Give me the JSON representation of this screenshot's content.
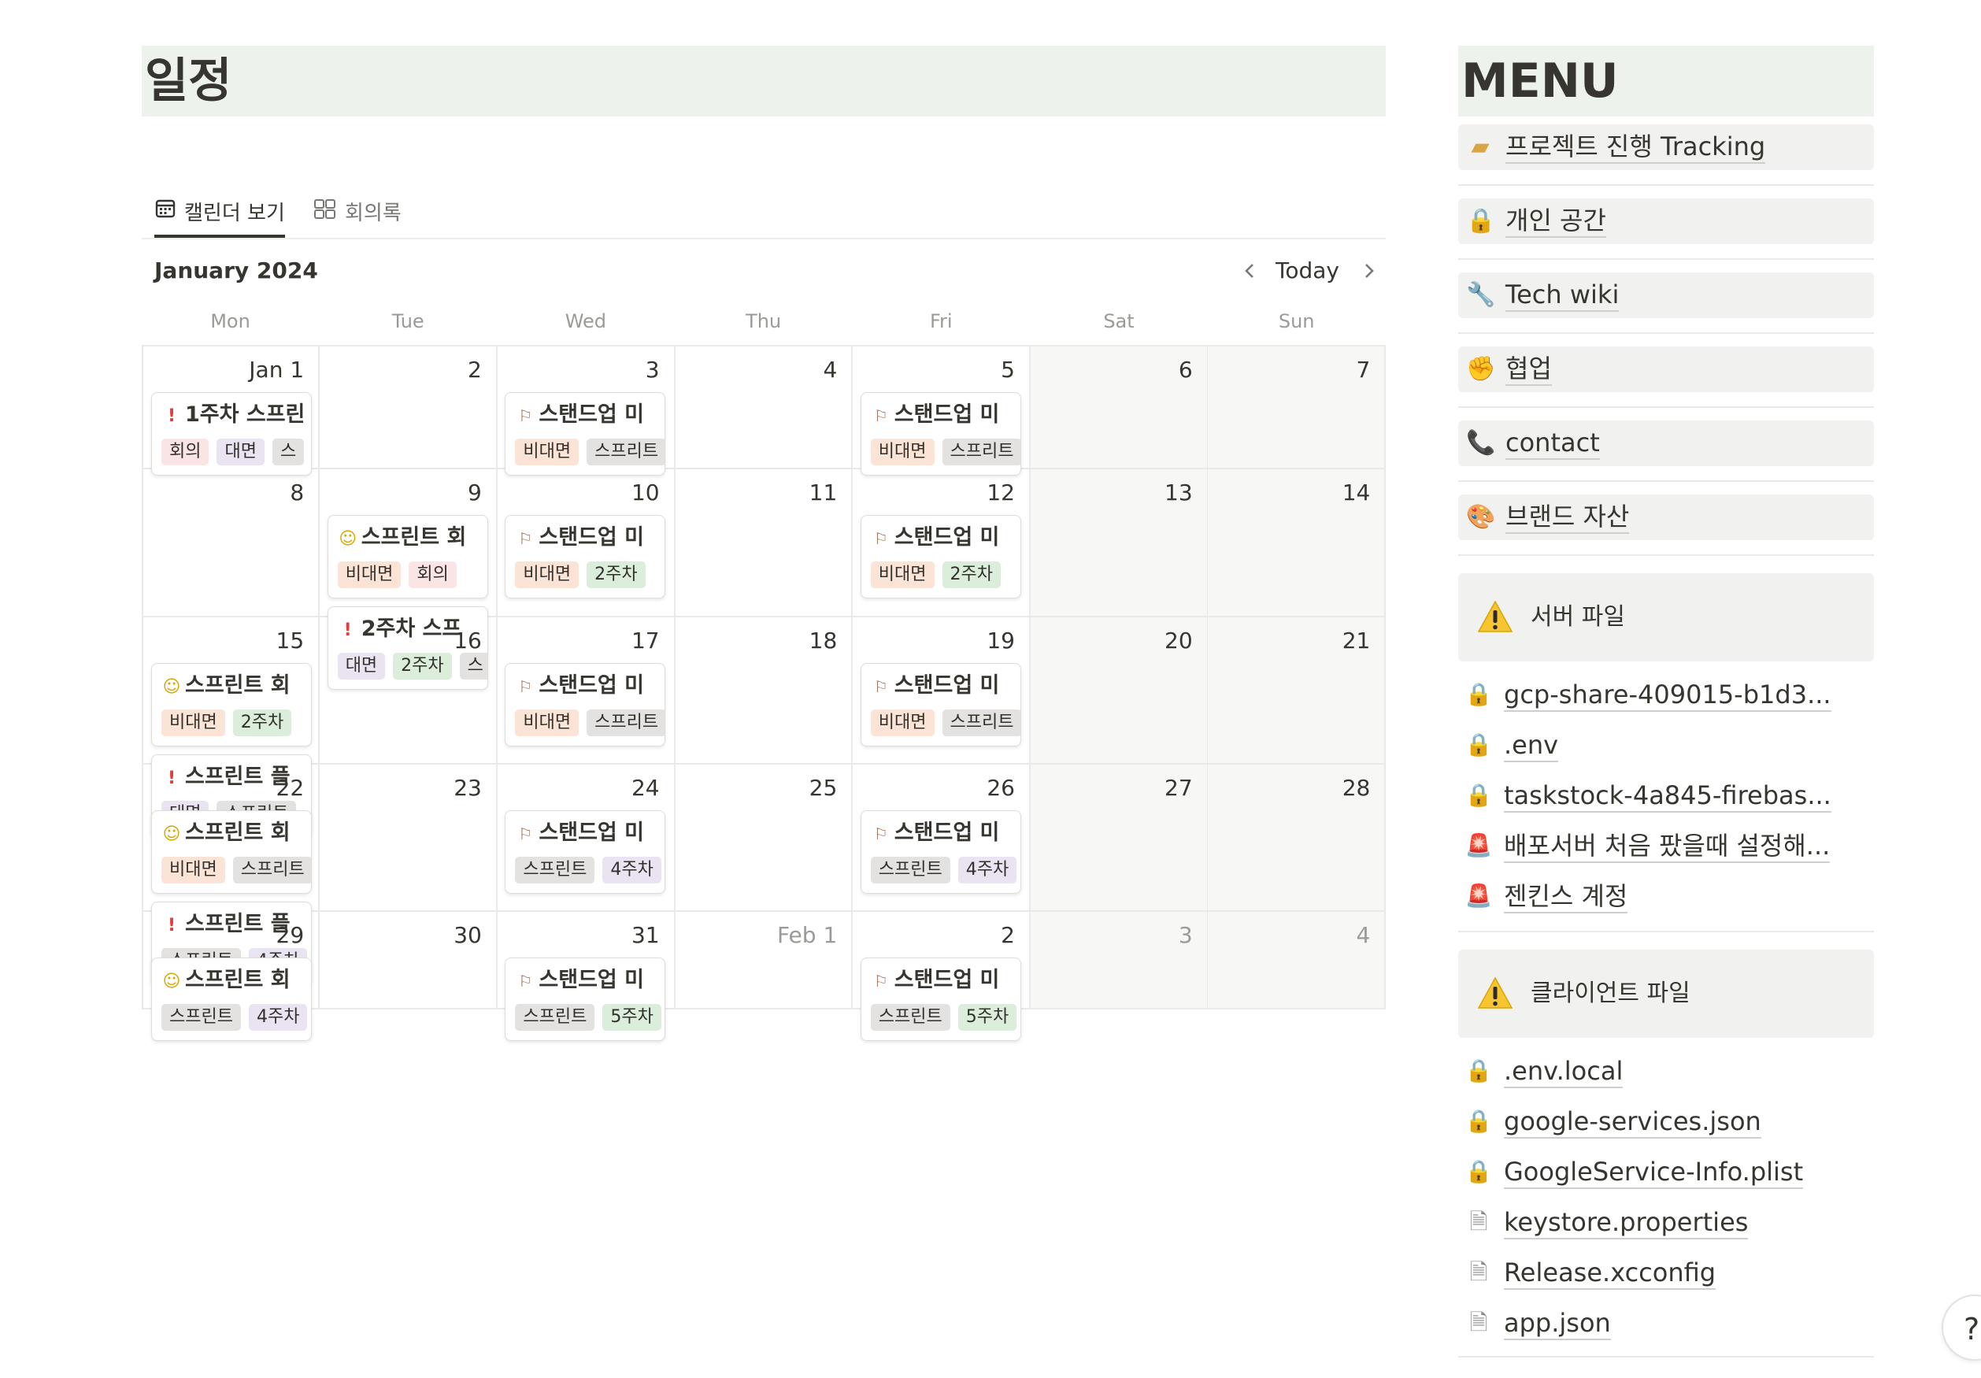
{
  "page": {
    "title": "일정"
  },
  "tabs": [
    {
      "label": "캘린더 보기",
      "icon": "calendar-icon",
      "active": true
    },
    {
      "label": "회의록",
      "icon": "gallery-icon",
      "active": false
    }
  ],
  "calendar": {
    "month_label": "January 2024",
    "today_label": "Today",
    "weekdays": [
      "Mon",
      "Tue",
      "Wed",
      "Thu",
      "Fri",
      "Sat",
      "Sun"
    ],
    "weeks": [
      {
        "days": [
          {
            "label": "Jan 1",
            "events": [
              {
                "icon": "exclamation-icon",
                "title": "1주차 스프린",
                "tags": [
                  {
                    "text": "회의",
                    "color": "red"
                  },
                  {
                    "text": "대면",
                    "color": "purple"
                  },
                  {
                    "text": "스",
                    "color": "gray"
                  }
                ]
              }
            ]
          },
          {
            "label": "2",
            "events": []
          },
          {
            "label": "3",
            "events": [
              {
                "icon": "runner-icon",
                "title": "스탠드업 미",
                "tags": [
                  {
                    "text": "비대면",
                    "color": "orange"
                  },
                  {
                    "text": "스프리트",
                    "color": "gray"
                  }
                ]
              }
            ]
          },
          {
            "label": "4",
            "events": []
          },
          {
            "label": "5",
            "events": [
              {
                "icon": "runner-icon",
                "title": "스탠드업 미",
                "tags": [
                  {
                    "text": "비대면",
                    "color": "orange"
                  },
                  {
                    "text": "스프리트",
                    "color": "gray"
                  }
                ]
              }
            ]
          },
          {
            "label": "6",
            "events": []
          },
          {
            "label": "7",
            "events": []
          }
        ]
      },
      {
        "days": [
          {
            "label": "8",
            "events": []
          },
          {
            "label": "9",
            "events": [
              {
                "icon": "smile-icon",
                "title": "스프린트 회",
                "tags": [
                  {
                    "text": "비대면",
                    "color": "orange"
                  },
                  {
                    "text": "회의",
                    "color": "red"
                  },
                  {
                    "text": "",
                    "color": "gray"
                  }
                ]
              },
              {
                "icon": "exclamation-icon",
                "title": "2주차 스프",
                "tags": [
                  {
                    "text": "대면",
                    "color": "purple"
                  },
                  {
                    "text": "2주차",
                    "color": "green"
                  },
                  {
                    "text": "스",
                    "color": "gray"
                  }
                ]
              }
            ]
          },
          {
            "label": "10",
            "events": [
              {
                "icon": "runner-icon",
                "title": "스탠드업 미",
                "tags": [
                  {
                    "text": "비대면",
                    "color": "orange"
                  },
                  {
                    "text": "2주차",
                    "color": "green"
                  }
                ]
              }
            ]
          },
          {
            "label": "11",
            "events": []
          },
          {
            "label": "12",
            "events": [
              {
                "icon": "runner-icon",
                "title": "스탠드업 미",
                "tags": [
                  {
                    "text": "비대면",
                    "color": "orange"
                  },
                  {
                    "text": "2주차",
                    "color": "green"
                  }
                ]
              }
            ]
          },
          {
            "label": "13",
            "events": []
          },
          {
            "label": "14",
            "events": []
          }
        ]
      },
      {
        "days": [
          {
            "label": "15",
            "events": [
              {
                "icon": "smile-icon",
                "title": "스프린트 회",
                "tags": [
                  {
                    "text": "비대면",
                    "color": "orange"
                  },
                  {
                    "text": "2주차",
                    "color": "green"
                  }
                ]
              },
              {
                "icon": "exclamation-icon",
                "title": "스프린트 플",
                "tags": [
                  {
                    "text": "대면",
                    "color": "purple"
                  },
                  {
                    "text": "스프린트",
                    "color": "gray"
                  }
                ]
              }
            ]
          },
          {
            "label": "16",
            "events": []
          },
          {
            "label": "17",
            "events": [
              {
                "icon": "runner-icon",
                "title": "스탠드업 미",
                "tags": [
                  {
                    "text": "비대면",
                    "color": "orange"
                  },
                  {
                    "text": "스프리트",
                    "color": "gray"
                  }
                ]
              }
            ]
          },
          {
            "label": "18",
            "events": []
          },
          {
            "label": "19",
            "events": [
              {
                "icon": "runner-icon",
                "title": "스탠드업 미",
                "tags": [
                  {
                    "text": "비대면",
                    "color": "orange"
                  },
                  {
                    "text": "스프리트",
                    "color": "gray"
                  }
                ]
              }
            ]
          },
          {
            "label": "20",
            "events": []
          },
          {
            "label": "21",
            "events": []
          }
        ]
      },
      {
        "days": [
          {
            "label": "22",
            "events": [
              {
                "icon": "smile-icon",
                "title": "스프린트 회",
                "tags": [
                  {
                    "text": "비대면",
                    "color": "orange"
                  },
                  {
                    "text": "스프리트",
                    "color": "gray"
                  }
                ]
              },
              {
                "icon": "exclamation-icon",
                "title": "스프린트 플",
                "tags": [
                  {
                    "text": "스프린트",
                    "color": "gray"
                  },
                  {
                    "text": "4주차",
                    "color": "purple"
                  }
                ]
              }
            ]
          },
          {
            "label": "23",
            "events": []
          },
          {
            "label": "24",
            "events": [
              {
                "icon": "runner-icon",
                "title": "스탠드업 미",
                "tags": [
                  {
                    "text": "스프린트",
                    "color": "gray"
                  },
                  {
                    "text": "4주차",
                    "color": "purple"
                  }
                ]
              }
            ]
          },
          {
            "label": "25",
            "events": []
          },
          {
            "label": "26",
            "events": [
              {
                "icon": "runner-icon",
                "title": "스탠드업 미",
                "tags": [
                  {
                    "text": "스프린트",
                    "color": "gray"
                  },
                  {
                    "text": "4주차",
                    "color": "purple"
                  }
                ]
              }
            ]
          },
          {
            "label": "27",
            "events": []
          },
          {
            "label": "28",
            "events": []
          }
        ]
      },
      {
        "days": [
          {
            "label": "29",
            "events": [
              {
                "icon": "smile-icon",
                "title": "스프린트 회",
                "tags": [
                  {
                    "text": "스프린트",
                    "color": "gray"
                  },
                  {
                    "text": "4주차",
                    "color": "purple"
                  }
                ]
              }
            ]
          },
          {
            "label": "30",
            "events": []
          },
          {
            "label": "31",
            "events": [
              {
                "icon": "runner-icon",
                "title": "스탠드업 미",
                "tags": [
                  {
                    "text": "스프린트",
                    "color": "gray"
                  },
                  {
                    "text": "5주차",
                    "color": "green"
                  }
                ]
              }
            ]
          },
          {
            "label": "Feb 1",
            "muted": true,
            "events": []
          },
          {
            "label": "2",
            "events": [
              {
                "icon": "runner-icon",
                "title": "스탠드업 미",
                "tags": [
                  {
                    "text": "스프린트",
                    "color": "gray"
                  },
                  {
                    "text": "5주차",
                    "color": "green"
                  }
                ]
              }
            ]
          },
          {
            "label": "3",
            "muted": true,
            "events": []
          },
          {
            "label": "4",
            "muted": true,
            "events": []
          }
        ]
      }
    ]
  },
  "sidebar": {
    "title": "MENU",
    "items": [
      {
        "icon": "memo-icon",
        "label": "프로젝트 진행 Tracking"
      },
      {
        "icon": "lock-icon",
        "label": "개인 공간"
      },
      {
        "icon": "wrench-icon",
        "label": "Tech wiki"
      },
      {
        "icon": "fist-icon",
        "label": "협업"
      },
      {
        "icon": "phone-icon",
        "label": "contact"
      },
      {
        "icon": "palette-icon",
        "label": "브랜드 자산"
      }
    ],
    "callouts": [
      {
        "icon": "warning-icon",
        "title": "서버 파일",
        "files": [
          {
            "icon": "lock-icon",
            "label": "gcp-share-409015-b1d3..."
          },
          {
            "icon": "lock-icon",
            "label": ".env"
          },
          {
            "icon": "lock-icon",
            "label": "taskstock-4a845-firebas..."
          },
          {
            "icon": "siren-icon",
            "label": "배포서버 처음 팠을때 설정해..."
          },
          {
            "icon": "siren-icon",
            "label": "젠킨스 계정"
          }
        ]
      },
      {
        "icon": "warning-icon",
        "title": "클라이언트 파일",
        "files": [
          {
            "icon": "lock-icon",
            "label": ".env.local"
          },
          {
            "icon": "lock-icon",
            "label": "google-services.json"
          },
          {
            "icon": "lock-icon",
            "label": "GoogleService-Info.plist"
          },
          {
            "icon": "document-icon",
            "label": "keystore.properties"
          },
          {
            "icon": "document-icon",
            "label": "Release.xcconfig"
          },
          {
            "icon": "document-icon",
            "label": "app.json"
          }
        ]
      }
    ]
  },
  "help": {
    "label": "?"
  },
  "colors": {
    "title_bg": "#edf3ec",
    "menu_item_bg": "#f1f1ef",
    "weekend_bg": "#f7f7f5",
    "tag_red": "#fbe4e4",
    "tag_purple": "#eae4f2",
    "tag_orange": "#fbe4d6",
    "tag_gray": "#e3e2e0",
    "tag_green": "#dbeddb"
  }
}
